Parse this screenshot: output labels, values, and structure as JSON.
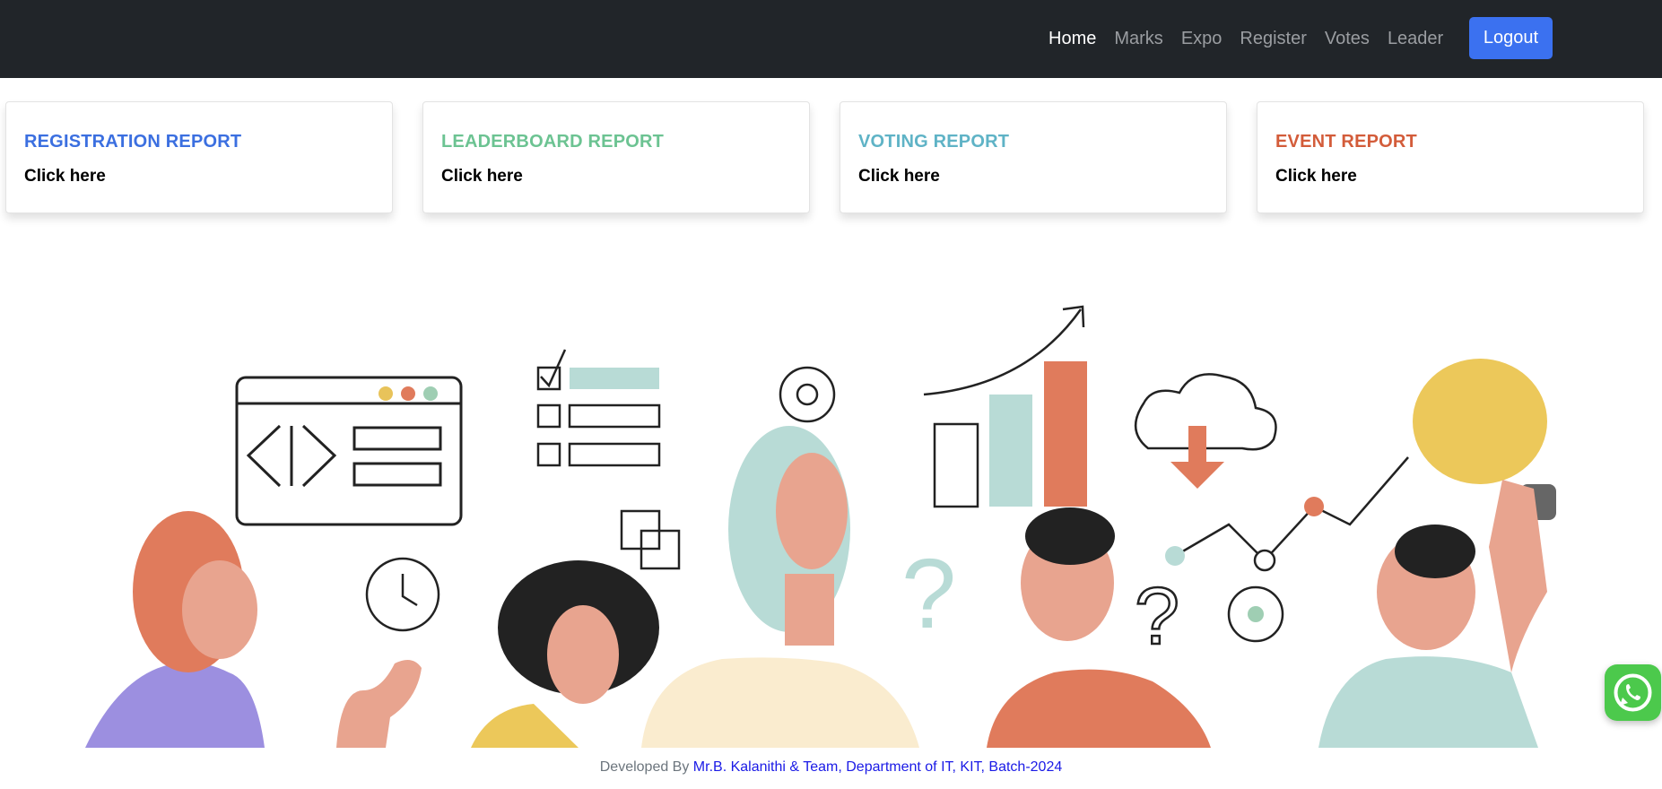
{
  "nav": {
    "links": [
      "Home",
      "Marks",
      "Expo",
      "Register",
      "Votes",
      "Leader"
    ],
    "active": "Home",
    "logout_label": "Logout"
  },
  "cards": [
    {
      "title": "REGISTRATION REPORT",
      "link": "Click here",
      "color": "#3b6fe0"
    },
    {
      "title": "LEADERBOARD REPORT",
      "link": "Click here",
      "color": "#6cc392"
    },
    {
      "title": "VOTING REPORT",
      "link": "Click here",
      "color": "#5fb3c6"
    },
    {
      "title": "EVENT REPORT",
      "link": "Click here",
      "color": "#d35c3a"
    }
  ],
  "footer": {
    "prefix": "Developed By ",
    "credit": "Mr.B. Kalanithi & Team, Department of IT, KIT, Batch-2024"
  },
  "illustration": {
    "icons": [
      "code-window-icon",
      "checklist-icon",
      "gear-icon",
      "bar-chart-icon",
      "cloud-download-icon",
      "lightbulb-icon",
      "stopwatch-icon",
      "question-mark-icon"
    ]
  },
  "floating": {
    "icon": "whatsapp-icon",
    "color": "#4cc94c"
  }
}
